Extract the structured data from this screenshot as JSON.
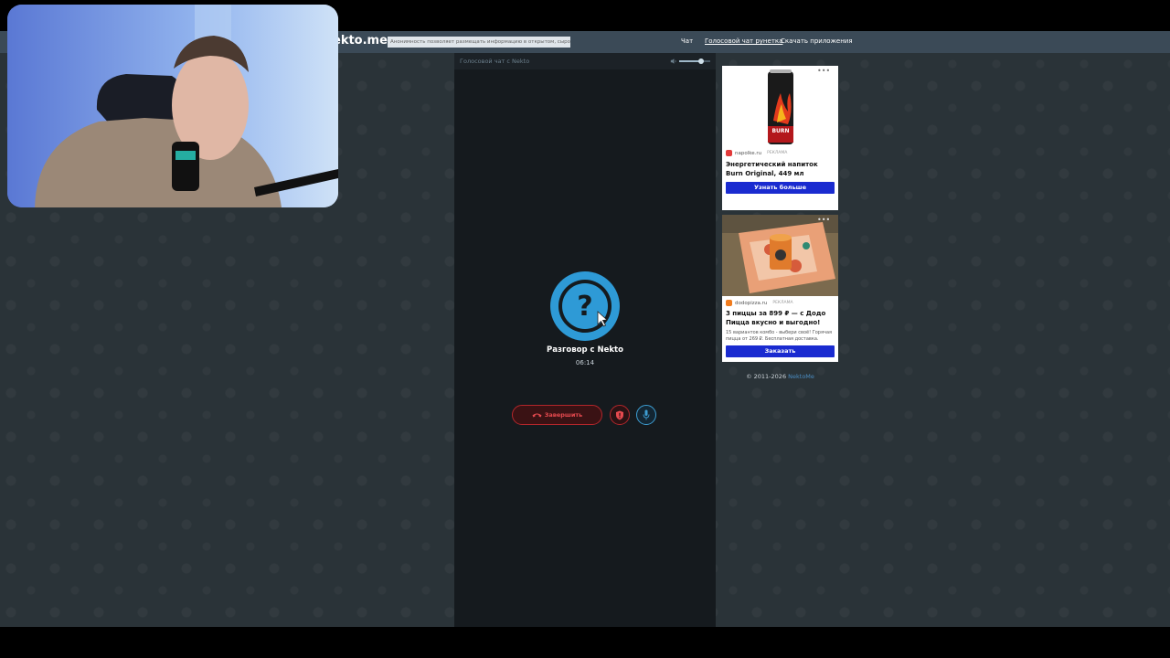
{
  "header": {
    "logo": "ekto.me",
    "disclaimer": "Анонимность позволяет размещать информацию в открытом, сыром виде",
    "nav": [
      {
        "label": "Чат",
        "active": false
      },
      {
        "label": "Голосовой чат рунетка",
        "active": true
      },
      {
        "label": "Скачать приложения",
        "active": false
      }
    ]
  },
  "chat": {
    "title": "Голосовой чат с Nekto",
    "volume": 0.7,
    "conversation_title": "Разговор с Nekto",
    "timer": "06:14",
    "end_label": "Завершить"
  },
  "ads": [
    {
      "source": "napolke.ru",
      "tag": "РЕКЛАМА",
      "headline": "Энергетический напиток Burn Original, 449 мл",
      "cta": "Узнать больше",
      "product_text": "BURN"
    },
    {
      "source": "dodopizza.ru",
      "tag": "РЕКЛАМА",
      "headline": "3 пиццы за 899 ₽ — с Додо Пицца вкусно и выгодно!",
      "description": "15 вариантов комбо - выбери своё! Горячая пицца от 269 ₽. Бесплатная доставка.",
      "cta": "Заказать"
    }
  ],
  "footer": {
    "copyright": "© 2011-2026",
    "link": "NektoMe"
  },
  "colors": {
    "accent": "#3d9ed3",
    "danger": "#b3262b",
    "ad_button": "#1a2bd0",
    "header_bg": "#3b4a57",
    "page_bg": "#2a3338"
  }
}
